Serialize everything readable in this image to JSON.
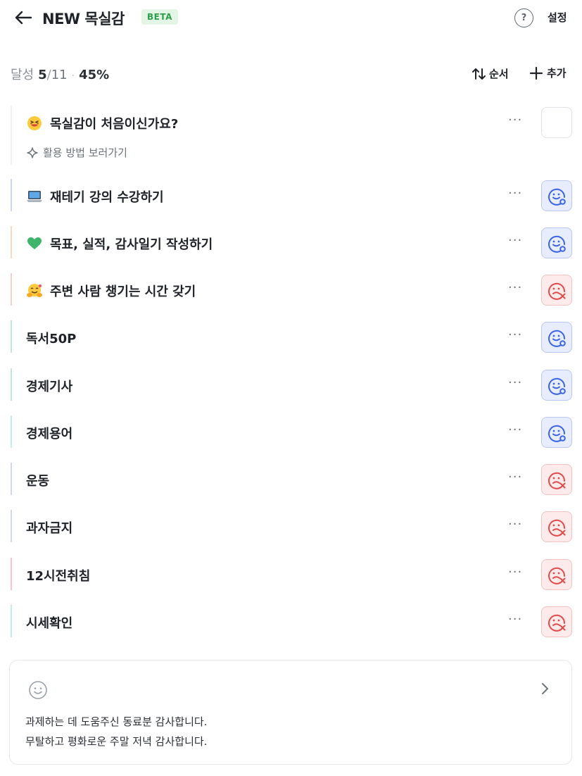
{
  "header": {
    "title": "NEW 목실감",
    "badge": "BETA",
    "help_label": "?",
    "settings_label": "설정"
  },
  "summary": {
    "label": "달성",
    "done": "5",
    "total": "11",
    "percent": "45%",
    "progress_value": 0.45
  },
  "toolbar": {
    "order_label": "순서",
    "add_label": "추가"
  },
  "guide": {
    "title": "목실감이 처음이신가요?",
    "emoji": "grinning-face-icon",
    "link_label": "활용 방법 보러가기",
    "more_label": "···"
  },
  "tasks": [
    {
      "title": "재테기 강의 수강하기",
      "emoji": "laptop-icon",
      "status": "done",
      "accent": "#c9d6f5"
    },
    {
      "title": "목표, 실적, 감사일기 작성하기",
      "emoji": "green-heart-icon",
      "status": "done",
      "accent": "#fbd8c0"
    },
    {
      "title": "주변 사람 챙기는 시간 갖기",
      "emoji": "hugging-face-icon",
      "status": "fail",
      "accent": "#f7cfc6"
    },
    {
      "title": "독서50P",
      "emoji": "",
      "status": "done",
      "accent": "#bfe8d6"
    },
    {
      "title": "경제기사",
      "emoji": "",
      "status": "done",
      "accent": "#bfe8d6"
    },
    {
      "title": "경제용어",
      "emoji": "",
      "status": "done",
      "accent": "#c4ecec"
    },
    {
      "title": "운동",
      "emoji": "",
      "status": "fail",
      "accent": "#cfdaf2"
    },
    {
      "title": "과자금지",
      "emoji": "",
      "status": "fail",
      "accent": "#cfdaf2"
    },
    {
      "title": "12시전취침",
      "emoji": "",
      "status": "fail",
      "accent": "#f5c5cf"
    },
    {
      "title": "시세확인",
      "emoji": "",
      "status": "fail",
      "accent": "#c4ecec"
    }
  ],
  "task_more_label": "···",
  "gratitude": {
    "lines": [
      "과제하는 데 도움주신 동료분 감사합니다.",
      "무탈하고 평화로운 주말 저녁 감사합니다."
    ]
  },
  "colors": {
    "done": "#3b64e6",
    "fail": "#e24b4b",
    "badge_bg": "#e3f6e6",
    "badge_text": "#2f9e4a"
  }
}
